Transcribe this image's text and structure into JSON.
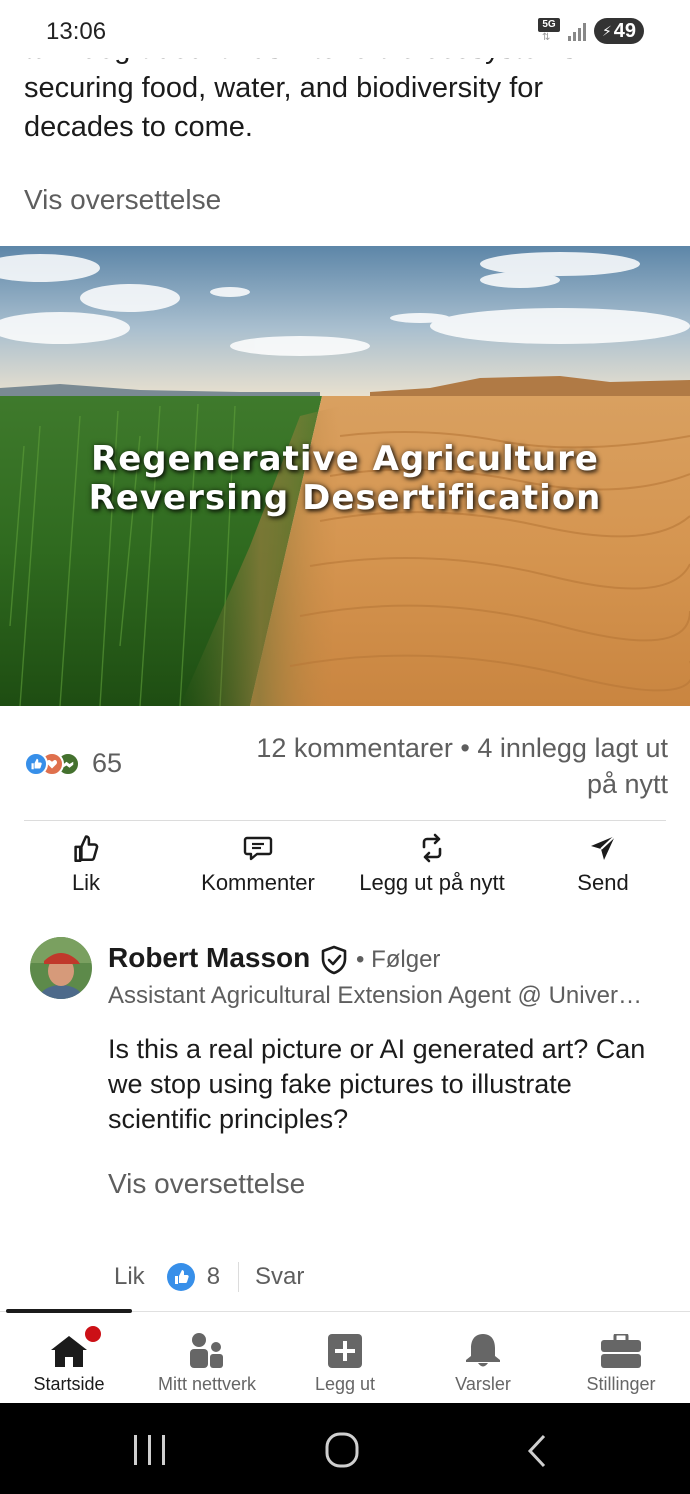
{
  "status_bar": {
    "time": "13:06",
    "network": "5G",
    "battery": "49"
  },
  "post": {
    "text_lines": [
      "turn degraded lands into fertile ecosystems",
      "securing food, water, and biodiversity for",
      "decades to come."
    ],
    "translate_label": "Vis oversettelse",
    "image": {
      "caption_line1": "Regenerative Agriculture",
      "caption_line2": "Reversing Desertification"
    },
    "reaction_count": "65",
    "counts_text": "12 kommentarer • 4 innlegg lagt ut på nytt"
  },
  "actions": {
    "like": "Lik",
    "comment": "Kommenter",
    "repost": "Legg ut på nytt",
    "send": "Send"
  },
  "comment": {
    "author": "Robert Masson",
    "follow_label": "• Følger",
    "headline": "Assistant Agricultural Extension Agent @ University",
    "body": "Is this a real picture or AI generated art? Can we stop using fake pictures to illustrate scientific principles?",
    "translate_label": "Vis oversettelse",
    "like_label": "Lik",
    "like_count": "8",
    "reply_label": "Svar"
  },
  "bottom_nav": [
    {
      "label": "Startside",
      "icon": "home-icon",
      "active": true
    },
    {
      "label": "Mitt nettverk",
      "icon": "network-icon"
    },
    {
      "label": "Legg ut",
      "icon": "post-icon"
    },
    {
      "label": "Varsler",
      "icon": "bell-icon"
    },
    {
      "label": "Stillinger",
      "icon": "briefcase-icon"
    }
  ],
  "colors": {
    "link_blue": "#378fe9",
    "notification_red": "#cc1016",
    "text_secondary": "#5e5e5e"
  }
}
